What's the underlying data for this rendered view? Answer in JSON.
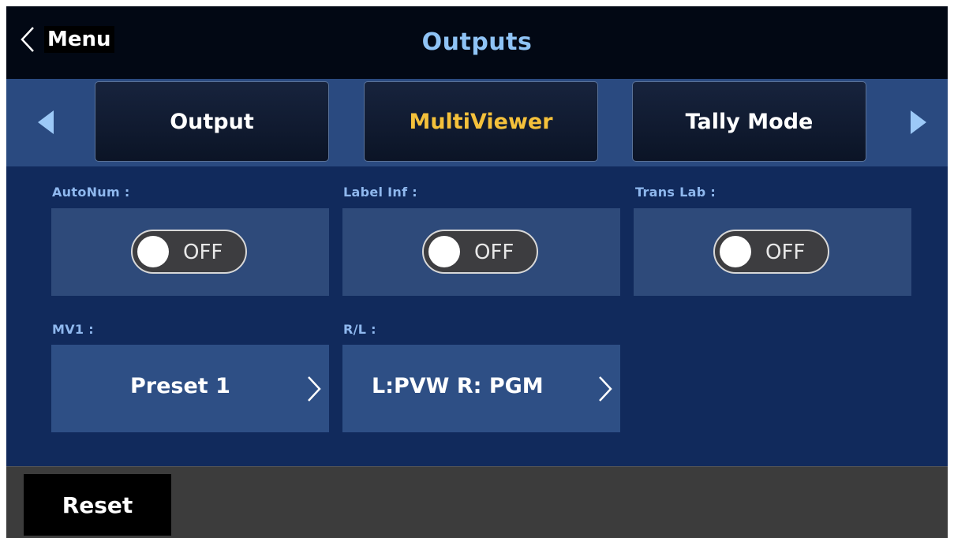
{
  "header": {
    "back_label": "Menu",
    "title": "Outputs"
  },
  "tabs": [
    {
      "label": "Output",
      "active": false
    },
    {
      "label": "MultiViewer",
      "active": true
    },
    {
      "label": "Tally Mode",
      "active": false
    }
  ],
  "fields": {
    "autonum": {
      "label": "AutoNum :",
      "state": "OFF"
    },
    "label_inf": {
      "label": "Label Inf :",
      "state": "OFF"
    },
    "trans_lab": {
      "label": "Trans Lab :",
      "state": "OFF"
    },
    "mv1": {
      "label": "MV1 :",
      "value": "Preset 1"
    },
    "rl": {
      "label": "R/L :",
      "value": "L:PVW R: PGM"
    }
  },
  "footer": {
    "reset_label": "Reset"
  },
  "colors": {
    "title": "#8fc3f5",
    "active_tab": "#f4c13b",
    "label": "#8fb8ee",
    "background": "#112a5c"
  },
  "icons": {
    "back": "chevron-left-icon",
    "prev": "triangle-left-icon",
    "next": "triangle-right-icon",
    "select": "chevron-right-icon"
  }
}
